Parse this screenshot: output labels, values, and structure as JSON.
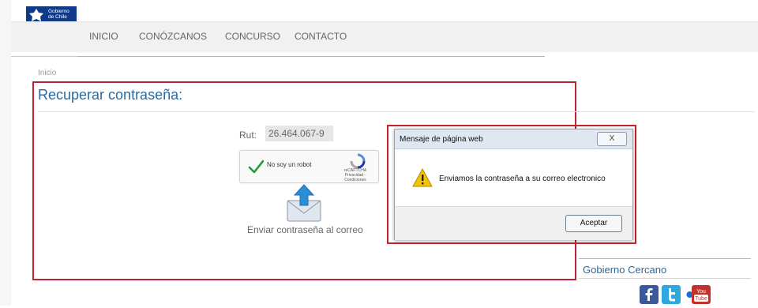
{
  "logo": {
    "line1": "Gobierno",
    "line2": "de Chile",
    "colors": {
      "blue": "#0f3a87",
      "red": "#d8262e"
    }
  },
  "nav": {
    "items": [
      "INICIO",
      "CONÓZCANOS",
      "CONCURSO",
      "CONTACTO"
    ]
  },
  "breadcrumb": "Inicio",
  "page_title": "Recuperar contraseña:",
  "form": {
    "rut_label": "Rut:",
    "rut_value": "26.464.067-9",
    "captcha_label": "No soy un robot",
    "captcha_brand": "reCAPTCHA",
    "captcha_links": "Privacidad - Condiciones",
    "send_label": "Enviar contraseña al correo"
  },
  "dialog": {
    "title": "Mensaje de página web",
    "close_glyph": "X",
    "message": "Enviamos la contraseña a su correo electronico",
    "ok_label": "Aceptar",
    "icon": "warning-icon"
  },
  "sidebar": {
    "title": "Gobierno Cercano",
    "social": [
      {
        "name": "facebook-icon",
        "glyph": "f",
        "color": "#3b5998"
      },
      {
        "name": "twitter-icon",
        "glyph": "t",
        "color": "#2fa8e0"
      },
      {
        "name": "flickr-icon",
        "glyph": "●●",
        "color": "#ffffff"
      },
      {
        "name": "youtube-icon",
        "glyph": "You Tube",
        "color": "#c4302b"
      }
    ]
  },
  "highlight_color": "#c0222f",
  "accent_color": "#2a6aa0"
}
